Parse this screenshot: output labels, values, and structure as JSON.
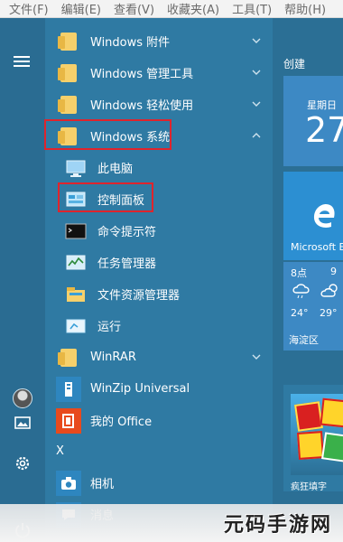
{
  "menubar": {
    "items": [
      "文件(F)",
      "编辑(E)",
      "查看(V)",
      "收藏夹(A)",
      "工具(T)",
      "帮助(H)"
    ]
  },
  "app_list": {
    "folders": [
      {
        "label": "Windows 附件"
      },
      {
        "label": "Windows 管理工具"
      },
      {
        "label": "Windows 轻松使用"
      },
      {
        "label": "Windows 系统"
      }
    ],
    "system_items": [
      {
        "label": "此电脑"
      },
      {
        "label": "控制面板"
      },
      {
        "label": "命令提示符"
      },
      {
        "label": "任务管理器"
      },
      {
        "label": "文件资源管理器"
      },
      {
        "label": "运行"
      }
    ],
    "other": [
      {
        "label": "WinRAR"
      },
      {
        "label": "WinZip Universal"
      },
      {
        "label": "我的 Office"
      }
    ],
    "section_x": "X",
    "x_items": [
      {
        "label": "相机"
      },
      {
        "label": "消息"
      }
    ]
  },
  "tiles": {
    "header": "创建",
    "date": {
      "weekday": "星期日",
      "day": "27"
    },
    "edge": {
      "label": "Microsoft E"
    },
    "weather": {
      "time1": "8点",
      "time2": "9",
      "temp1": "24°",
      "temp2": "29°",
      "location": "海淀区"
    },
    "game": {
      "label": "疯狂填字"
    }
  },
  "watermark": {
    "text": "元码手游网"
  },
  "colors": {
    "highlight": "#e0242c",
    "list_bg": "#2f7aa3",
    "tile_blue": "#3d89c4"
  }
}
